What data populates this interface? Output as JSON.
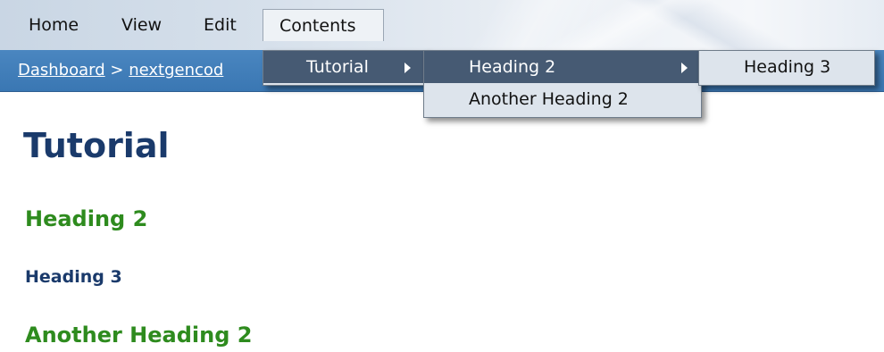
{
  "menubar": {
    "items": [
      "Home",
      "View",
      "Edit",
      "Contents"
    ],
    "active": "Contents"
  },
  "breadcrumb": {
    "root": "Dashboard",
    "separator": ">",
    "current": "nextgencod"
  },
  "menus": {
    "contents": [
      "Tutorial"
    ],
    "tutorial": [
      "Heading 2",
      "Another Heading 2"
    ],
    "heading2": [
      "Heading 3"
    ]
  },
  "content": {
    "title": "Tutorial",
    "headings": [
      {
        "level": 2,
        "text": "Heading 2"
      },
      {
        "level": 3,
        "text": "Heading 3"
      },
      {
        "level": 2,
        "text": "Another Heading 2"
      }
    ]
  },
  "colors": {
    "crumb_bar": "#3a77b3",
    "menu_highlight": "#465a73",
    "title": "#1a3a6b",
    "heading2": "#2e8b1e"
  },
  "icons": [
    "submenu-arrow-icon"
  ]
}
